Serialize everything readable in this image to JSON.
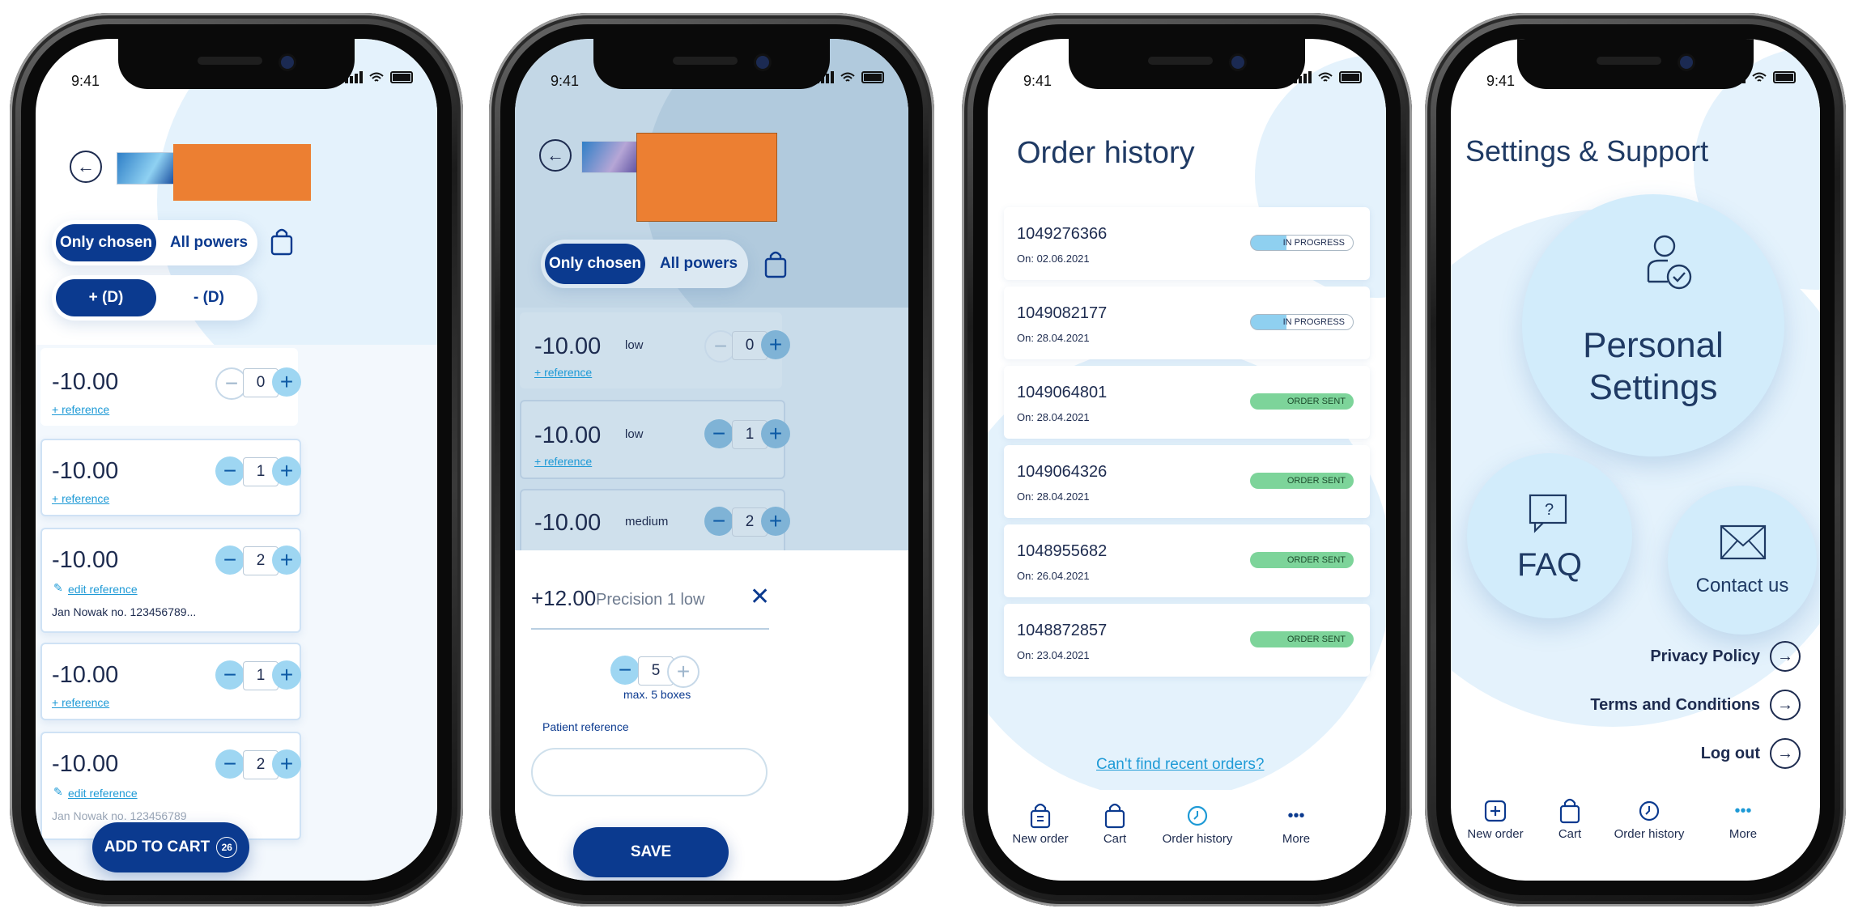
{
  "status_time": "9:41",
  "screen1": {
    "toggle_chosen": "Only chosen",
    "toggle_all": "All powers",
    "toggle_plus": "+ (D)",
    "toggle_minus": "- (D)",
    "rows": [
      {
        "power": "-10.00",
        "qty": "0",
        "ref": "+ reference",
        "note": ""
      },
      {
        "power": "-10.00",
        "qty": "1",
        "ref": "+ reference",
        "note": ""
      },
      {
        "power": "-10.00",
        "qty": "2",
        "ref": "edit reference",
        "note": "Jan Nowak no. 123456789..."
      },
      {
        "power": "-10.00",
        "qty": "1",
        "ref": "+ reference",
        "note": ""
      },
      {
        "power": "-10.00",
        "qty": "2",
        "ref": "edit reference",
        "note": "Jan Nowak no. 123456789"
      }
    ],
    "add_to_cart": "ADD TO CART",
    "cart_count": "26"
  },
  "screen2": {
    "toggle_chosen": "Only chosen",
    "toggle_all": "All powers",
    "rows": [
      {
        "power": "-10.00",
        "level": "low",
        "qty": "0",
        "ref": "+ reference"
      },
      {
        "power": "-10.00",
        "level": "low",
        "qty": "1",
        "ref": "+ reference"
      },
      {
        "power": "-10.00",
        "level": "medium",
        "qty": "2",
        "ref": ""
      }
    ],
    "sheet_power": "+12.00",
    "sheet_product": "Precision 1 low",
    "sheet_qty": "5",
    "sheet_max": "max. 5 boxes",
    "patient_ref_label": "Patient reference",
    "patient_ref_value": "",
    "save": "SAVE"
  },
  "screen3": {
    "title": "Order history",
    "orders": [
      {
        "number": "1049276366",
        "date": "On: 02.06.2021",
        "status": "IN PROGRESS",
        "kind": "prog"
      },
      {
        "number": "1049082177",
        "date": "On: 28.04.2021",
        "status": "IN PROGRESS",
        "kind": "prog"
      },
      {
        "number": "1049064801",
        "date": "On: 28.04.2021",
        "status": "ORDER SENT",
        "kind": "sent"
      },
      {
        "number": "1049064326",
        "date": "On: 28.04.2021",
        "status": "ORDER SENT",
        "kind": "sent"
      },
      {
        "number": "1048955682",
        "date": "On: 26.04.2021",
        "status": "ORDER SENT",
        "kind": "sent"
      },
      {
        "number": "1048872857",
        "date": "On: 23.04.2021",
        "status": "ORDER SENT",
        "kind": "sent"
      }
    ],
    "cant_find": "Can't find recent orders?",
    "nav": [
      "New order",
      "Cart",
      "Order history",
      "More"
    ]
  },
  "screen4": {
    "title": "Settings & Support",
    "personal_line1": "Personal",
    "personal_line2": "Settings",
    "faq": "FAQ",
    "contact": "Contact us",
    "privacy": "Privacy Policy",
    "terms": "Terms and Conditions",
    "logout": "Log out",
    "nav": [
      "New order",
      "Cart",
      "Order history",
      "More"
    ]
  },
  "colors": {
    "primary": "#0b3a8f",
    "accent": "#1e9ad6",
    "light": "#d2ecfb",
    "redacted": "#ec7f32",
    "sent": "#7dd49a"
  }
}
